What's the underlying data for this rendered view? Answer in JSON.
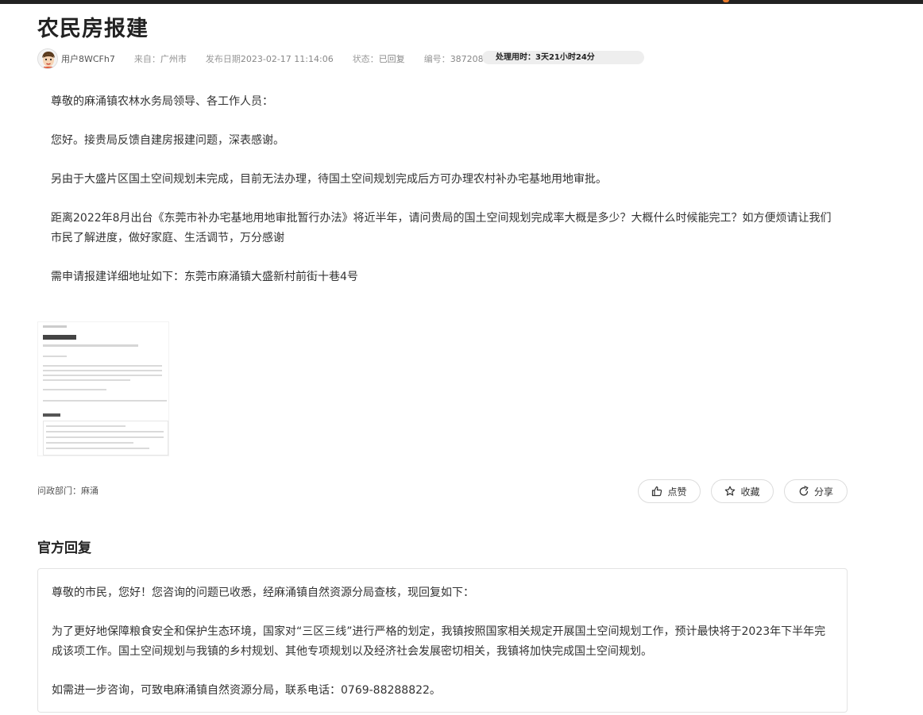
{
  "page": {
    "title": "农民房报建"
  },
  "meta": {
    "user": "用户8WCFh7",
    "from_label": "来自：",
    "from_value": "广州市",
    "date_label": "发布日期",
    "date_value": "2023-02-17 11:14:06",
    "status_label": "状态：",
    "status_value": "已回复",
    "number_label": "编号：",
    "number_value": "387208",
    "processing_time": "处理用时：3天21小时24分"
  },
  "content": {
    "paragraphs": [
      "尊敬的麻涌镇农林水务局领导、各工作人员：",
      "您好。接贵局反馈自建房报建问题，深表感谢。",
      "另由于大盛片区国土空间规划未完成，目前无法办理，待国土空间规划完成后方可办理农村补办宅基地用地审批。",
      "距离2022年8月出台《东莞市补办宅基地用地审批暂行办法》将近半年，请问贵局的国土空间规划完成率大概是多少？大概什么时候能完工？如方便烦请让我们市民了解进度，做好家庭、生活调节，万分感谢",
      "需申请报建详细地址如下：东莞市麻涌镇大盛新村前街十巷4号"
    ]
  },
  "dept": {
    "label": "问政部门：",
    "value": "麻涌"
  },
  "actions": {
    "like": "点赞",
    "favorite": "收藏",
    "share": "分享"
  },
  "reply": {
    "title": "官方回复",
    "paragraphs": [
      "尊敬的市民，您好！您咨询的问题已收悉，经麻涌镇自然资源分局查核，现回复如下：",
      "为了更好地保障粮食安全和保护生态环境，国家对“三区三线”进行严格的划定，我镇按照国家相关规定开展国土空间规划工作，预计最快将于2023年下半年完成该项工作。国土空间规划与我镇的乡村规划、其他专项规划以及经济社会发展密切相关，我镇将加快完成国土空间规划。",
      "如需进一步咨询，可致电麻涌镇自然资源分局，联系电话：0769-88288822。"
    ]
  },
  "colors": {
    "top_bar": "#222222",
    "accent": "#e8792b",
    "pill_bg": "#eeeeee"
  },
  "icons": {
    "like": "thumbs-up-icon",
    "favorite": "star-icon",
    "share": "share-icon"
  }
}
